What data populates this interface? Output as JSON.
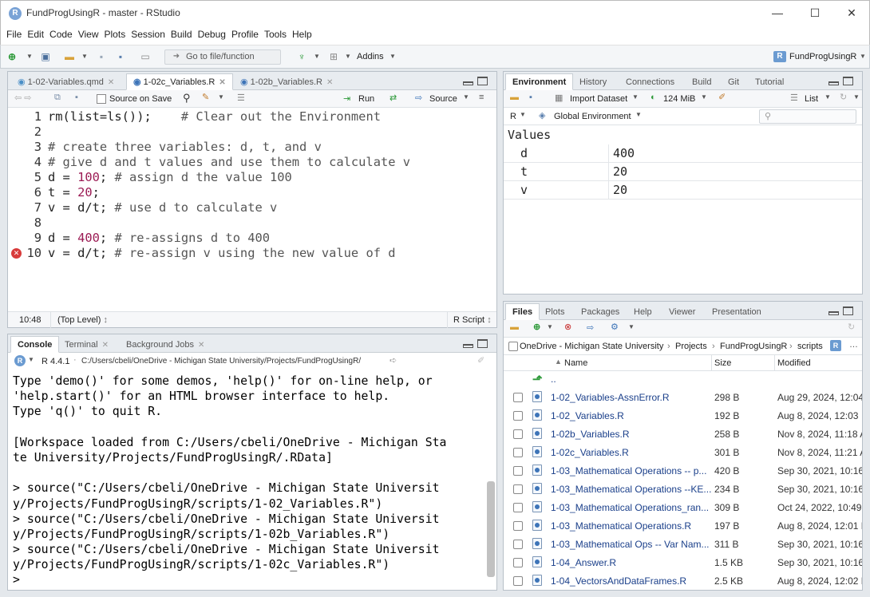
{
  "window": {
    "title": "FundProgUsingR - master - RStudio",
    "controls": {
      "minimize": "—",
      "maximize": "☐",
      "close": "✕"
    }
  },
  "menu": [
    "File",
    "Edit",
    "Code",
    "View",
    "Plots",
    "Session",
    "Build",
    "Debug",
    "Profile",
    "Tools",
    "Help"
  ],
  "toolbar": {
    "goto_placeholder": "Go to file/function",
    "addins_label": "Addins",
    "project_label": "FundProgUsingR"
  },
  "editor": {
    "tabs": [
      {
        "label": "1-02-Variables.qmd",
        "active": false
      },
      {
        "label": "1-02c_Variables.R",
        "active": true
      },
      {
        "label": "1-02b_Variables.R",
        "active": false
      }
    ],
    "source_on_save_label": "Source on Save",
    "run_label": "Run",
    "source_label": "Source",
    "lines": [
      {
        "n": "1",
        "parts": [
          [
            "rm(list=ls());    ",
            "code"
          ],
          [
            "# Clear out the Environment",
            "cmt"
          ]
        ]
      },
      {
        "n": "2",
        "parts": []
      },
      {
        "n": "3",
        "parts": [
          [
            "# create three variables: d, t, and v",
            "cmt"
          ]
        ]
      },
      {
        "n": "4",
        "parts": [
          [
            "# give d and t values and use them to calculate v",
            "cmt"
          ]
        ]
      },
      {
        "n": "5",
        "parts": [
          [
            "d = ",
            "code"
          ],
          [
            "100",
            "num"
          ],
          [
            "; ",
            "code"
          ],
          [
            "# assign d the value 100",
            "cmt"
          ]
        ]
      },
      {
        "n": "6",
        "parts": [
          [
            "t = ",
            "code"
          ],
          [
            "20",
            "num"
          ],
          [
            ";",
            "code"
          ]
        ]
      },
      {
        "n": "7",
        "parts": [
          [
            "v = d/t; ",
            "code"
          ],
          [
            "# use d to calculate v",
            "cmt"
          ]
        ]
      },
      {
        "n": "8",
        "parts": []
      },
      {
        "n": "9",
        "parts": [
          [
            "d = ",
            "code"
          ],
          [
            "400",
            "num"
          ],
          [
            "; ",
            "code"
          ],
          [
            "# re-assigns d to 400",
            "cmt"
          ]
        ]
      },
      {
        "n": "10",
        "parts": [
          [
            "v = d/t; ",
            "code"
          ],
          [
            "# re-assign v using the new value of d",
            "cmt"
          ]
        ],
        "error": true
      }
    ],
    "status": {
      "position": "10:48",
      "scope": "(Top Level)",
      "filetype": "R Script"
    }
  },
  "console": {
    "tabs": [
      {
        "label": "Console",
        "active": true
      },
      {
        "label": "Terminal",
        "active": false
      },
      {
        "label": "Background Jobs",
        "active": false
      }
    ],
    "r_version": "R 4.4.1",
    "path": "C:/Users/cbeli/OneDrive - Michigan State University/Projects/FundProgUsingR/",
    "lines": [
      "Type 'demo()' for some demos, 'help()' for on-line help, or",
      "'help.start()' for an HTML browser interface to help.",
      "Type 'q()' to quit R.",
      "",
      "[Workspace loaded from C:/Users/cbeli/OneDrive - Michigan Sta",
      "te University/Projects/FundProgUsingR/.RData]",
      "",
      "> source(\"C:/Users/cbeli/OneDrive - Michigan State Universit",
      "y/Projects/FundProgUsingR/scripts/1-02_Variables.R\")",
      "> source(\"C:/Users/cbeli/OneDrive - Michigan State Universit",
      "y/Projects/FundProgUsingR/scripts/1-02b_Variables.R\")",
      "> source(\"C:/Users/cbeli/OneDrive - Michigan State Universit",
      "y/Projects/FundProgUsingR/scripts/1-02c_Variables.R\")",
      "> "
    ]
  },
  "environment": {
    "tabs": [
      {
        "label": "Environment",
        "active": true
      },
      {
        "label": "History",
        "active": false
      },
      {
        "label": "Connections",
        "active": false
      },
      {
        "label": "Build",
        "active": false
      },
      {
        "label": "Git",
        "active": false
      },
      {
        "label": "Tutorial",
        "active": false
      }
    ],
    "import_label": "Import Dataset",
    "memory_label": "124 MiB",
    "view_label": "List",
    "lang_label": "R",
    "scope_label": "Global Environment",
    "section_label": "Values",
    "values": [
      {
        "name": "d",
        "value": "400"
      },
      {
        "name": "t",
        "value": "20"
      },
      {
        "name": "v",
        "value": "20"
      }
    ]
  },
  "files": {
    "tabs": [
      {
        "label": "Files",
        "active": true
      },
      {
        "label": "Plots",
        "active": false
      },
      {
        "label": "Packages",
        "active": false
      },
      {
        "label": "Help",
        "active": false
      },
      {
        "label": "Viewer",
        "active": false
      },
      {
        "label": "Presentation",
        "active": false
      }
    ],
    "breadcrumb": [
      "OneDrive - Michigan State University",
      "Projects",
      "FundProgUsingR",
      "scripts"
    ],
    "columns": {
      "name": "Name",
      "size": "Size",
      "modified": "Modified"
    },
    "up_label": "..",
    "rows": [
      {
        "name": "1-02_Variables-AssnError.R",
        "size": "298 B",
        "modified": "Aug 29, 2024, 12:04"
      },
      {
        "name": "1-02_Variables.R",
        "size": "192 B",
        "modified": "Aug 8, 2024, 12:03"
      },
      {
        "name": "1-02b_Variables.R",
        "size": "258 B",
        "modified": "Nov 8, 2024, 11:18 A"
      },
      {
        "name": "1-02c_Variables.R",
        "size": "301 B",
        "modified": "Nov 8, 2024, 11:21 A"
      },
      {
        "name": "1-03_Mathematical Operations -- p...",
        "size": "420 B",
        "modified": "Sep 30, 2021, 10:16"
      },
      {
        "name": "1-03_Mathematical Operations --KE...",
        "size": "234 B",
        "modified": "Sep 30, 2021, 10:16"
      },
      {
        "name": "1-03_Mathematical Operations_ran...",
        "size": "309 B",
        "modified": "Oct 24, 2022, 10:49"
      },
      {
        "name": "1-03_Mathematical Operations.R",
        "size": "197 B",
        "modified": "Aug 8, 2024, 12:01 F"
      },
      {
        "name": "1-03_Mathematical Ops -- Var Nam...",
        "size": "311 B",
        "modified": "Sep 30, 2021, 10:16"
      },
      {
        "name": "1-04_Answer.R",
        "size": "1.5 KB",
        "modified": "Sep 30, 2021, 10:16"
      },
      {
        "name": "1-04_VectorsAndDataFrames.R",
        "size": "2.5 KB",
        "modified": "Aug 8, 2024, 12:02 F"
      }
    ]
  }
}
